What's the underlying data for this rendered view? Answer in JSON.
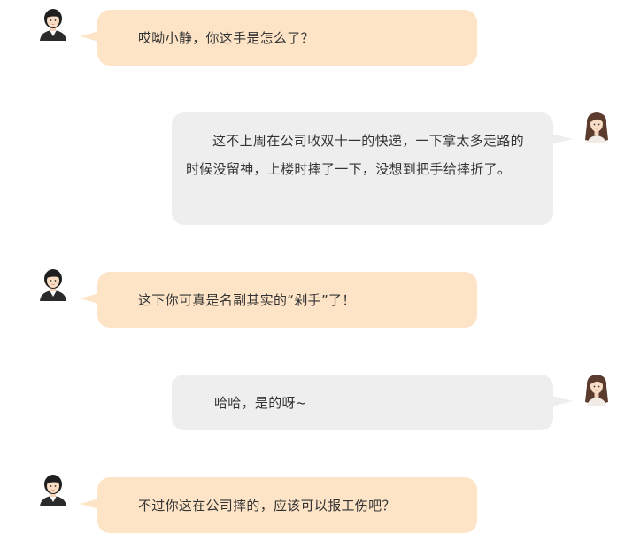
{
  "colors": {
    "left_bubble": "#fde4c7",
    "right_bubble": "#eeeeef",
    "text": "#333333"
  },
  "messages": [
    {
      "side": "left",
      "avatar": "short-hair-woman-avatar",
      "text": "哎呦小静，你这手是怎么了？"
    },
    {
      "side": "right",
      "avatar": "long-hair-woman-avatar",
      "text": "这不上周在公司收双十一的快递，一下拿太多走路的时候没留神，上楼时摔了一下，没想到把手给摔折了。"
    },
    {
      "side": "left",
      "avatar": "short-hair-woman-avatar",
      "text": "这下你可真是名副其实的“剁手”了！"
    },
    {
      "side": "right",
      "avatar": "long-hair-woman-avatar",
      "text": "哈哈，是的呀~"
    },
    {
      "side": "left",
      "avatar": "short-hair-woman-avatar",
      "text": "不过你这在公司摔的，应该可以报工伤吧？"
    }
  ]
}
